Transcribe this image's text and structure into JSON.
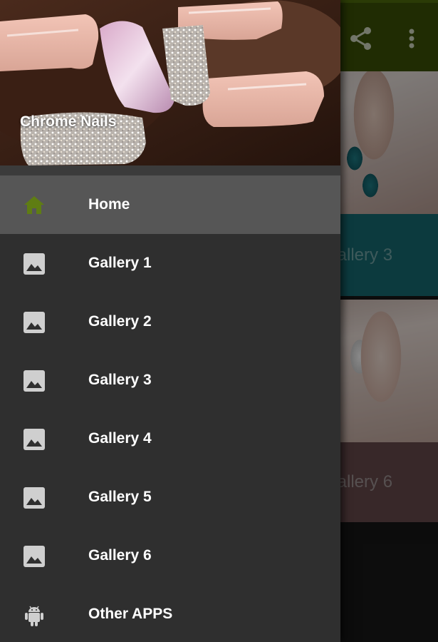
{
  "app": {
    "title": "Chrome Nails",
    "background_tiles": [
      {
        "caption": "Gallery 3"
      },
      {
        "caption": "Gallery 6"
      }
    ],
    "toolbar_icons": [
      "share-icon",
      "more-vert-icon"
    ]
  },
  "drawer": {
    "items": [
      {
        "label": "Home",
        "icon": "home-icon",
        "active": true
      },
      {
        "label": "Gallery 1",
        "icon": "image-icon"
      },
      {
        "label": "Gallery 2",
        "icon": "image-icon"
      },
      {
        "label": "Gallery 3",
        "icon": "image-icon"
      },
      {
        "label": "Gallery 4",
        "icon": "image-icon"
      },
      {
        "label": "Gallery 5",
        "icon": "image-icon"
      },
      {
        "label": "Gallery 6",
        "icon": "image-icon"
      },
      {
        "label": "Other APPS",
        "icon": "android-icon"
      }
    ]
  },
  "colors": {
    "toolbar": "#3b5106",
    "accent": "#5f7d13",
    "drawer_bg": "#2f2f2f",
    "active_item": "#565656",
    "tile_teal": "#176b71",
    "tile_mauve": "#674a4c"
  }
}
